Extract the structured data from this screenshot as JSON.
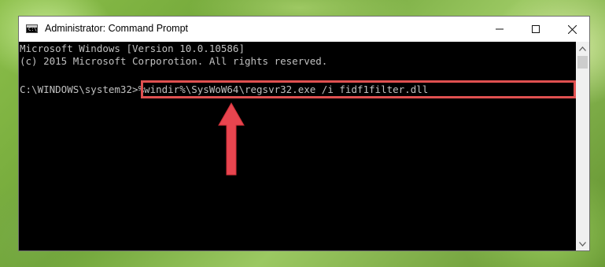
{
  "window": {
    "title": "Administrator: Command Prompt",
    "icon": "cmd-icon",
    "controls": {
      "minimize": "minimize-icon",
      "maximize": "maximize-icon",
      "close": "close-icon"
    }
  },
  "console": {
    "lines": [
      "Microsoft Windows [Version 10.0.10586]",
      "(c) 2015 Microsoft Corporotion. All rights reserved."
    ],
    "prompt": "C:\\WINDOWS\\system32>",
    "command": "%windir%\\SysWoW64\\regsvr32.exe /i fidf1filter.dll",
    "text_color": "#c0c0c0",
    "background_color": "#000000"
  },
  "annotations": {
    "highlight_color": "#e05050",
    "arrow": "up-arrow-icon"
  }
}
